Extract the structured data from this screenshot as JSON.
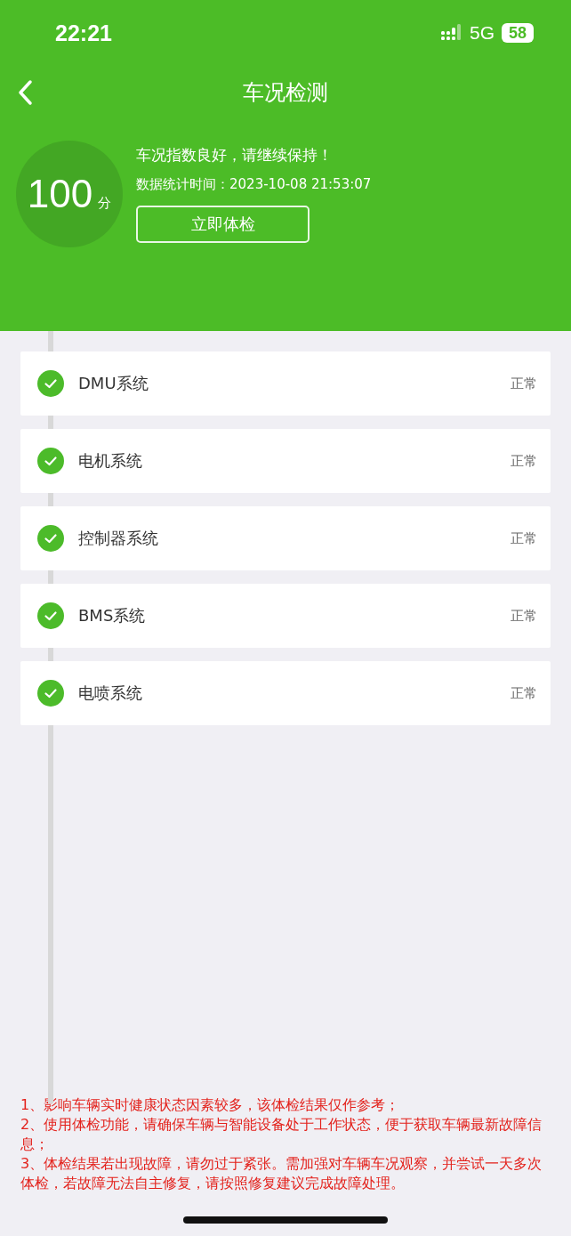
{
  "status_bar": {
    "time": "22:21",
    "network": "5G",
    "battery": "58"
  },
  "nav": {
    "title": "车况检测"
  },
  "summary": {
    "score": "100",
    "unit": "分",
    "message": "车况指数良好，请继续保持！",
    "time_label": "数据统计时间：",
    "time": "2023-10-08 21:53:07",
    "button": "立即体检"
  },
  "systems": [
    {
      "name": "DMU系统",
      "status": "正常",
      "ok": true
    },
    {
      "name": "电机系统",
      "status": "正常",
      "ok": true
    },
    {
      "name": "控制器系统",
      "status": "正常",
      "ok": true
    },
    {
      "name": "BMS系统",
      "status": "正常",
      "ok": true
    },
    {
      "name": "电喷系统",
      "status": "正常",
      "ok": true
    }
  ],
  "notes": [
    "1、影响车辆实时健康状态因素较多，该体检结果仅作参考；",
    "2、使用体检功能，请确保车辆与智能设备处于工作状态，便于获取车辆最新故障信息；",
    "3、体检结果若出现故障，请勿过于紧张。需加强对车辆车况观察，并尝试一天多次体检，若故障无法自主修复，请按照修复建议完成故障处理。"
  ]
}
